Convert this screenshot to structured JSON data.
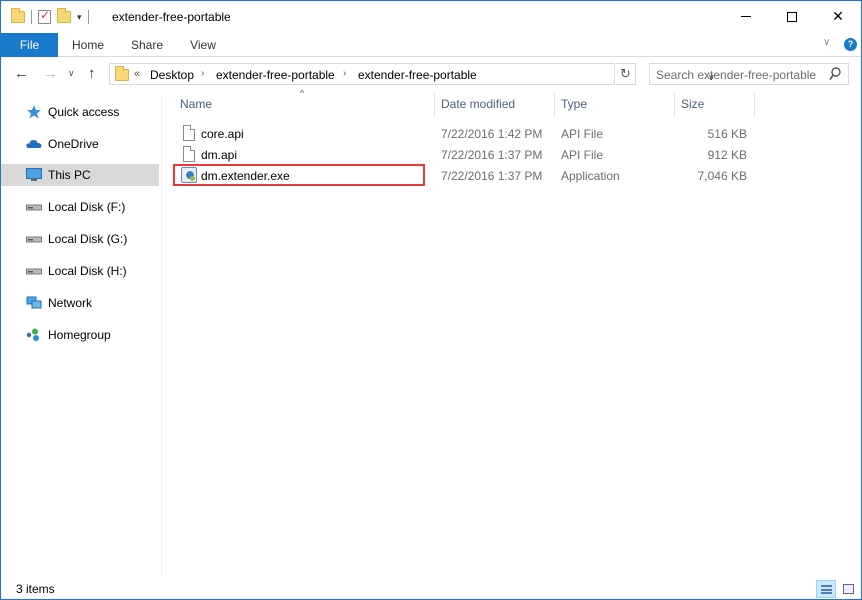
{
  "window": {
    "title": "extender-free-portable",
    "controls": {
      "minimize": "Minimize",
      "maximize": "Maximize",
      "close": "Close"
    }
  },
  "ribbon": {
    "tabs": [
      {
        "label": "File"
      },
      {
        "label": "Home"
      },
      {
        "label": "Share"
      },
      {
        "label": "View"
      }
    ]
  },
  "address": {
    "overflow": "«",
    "crumbs": [
      "Desktop",
      "extender-free-portable",
      "extender-free-portable"
    ]
  },
  "search": {
    "placeholder": "Search extender-free-portable"
  },
  "sidebar": {
    "items": [
      {
        "label": "Quick access",
        "icon": "star-icon"
      },
      {
        "label": "OneDrive",
        "icon": "cloud-icon"
      },
      {
        "label": "This PC",
        "icon": "monitor-icon",
        "active": true
      },
      {
        "label": "Local Disk (F:)",
        "icon": "drive-icon"
      },
      {
        "label": "Local Disk (G:)",
        "icon": "drive-icon"
      },
      {
        "label": "Local Disk (H:)",
        "icon": "drive-icon"
      },
      {
        "label": "Network",
        "icon": "network-icon"
      },
      {
        "label": "Homegroup",
        "icon": "homegroup-icon"
      }
    ]
  },
  "filelist": {
    "columns": [
      "Name",
      "Date modified",
      "Type",
      "Size"
    ],
    "rows": [
      {
        "name": "core.api",
        "date": "7/22/2016 1:42 PM",
        "type": "API File",
        "size": "516 KB",
        "icon": "file-icon"
      },
      {
        "name": "dm.api",
        "date": "7/22/2016 1:37 PM",
        "type": "API File",
        "size": "912 KB",
        "icon": "file-icon"
      },
      {
        "name": "dm.extender.exe",
        "date": "7/22/2016 1:37 PM",
        "type": "Application",
        "size": "7,046 KB",
        "icon": "application-icon",
        "highlighted": true
      }
    ]
  },
  "status": {
    "item_count": "3 items"
  },
  "colors": {
    "accent": "#1979ca",
    "highlight_box": "#e53935",
    "selected_nav": "#d9d9d9"
  }
}
